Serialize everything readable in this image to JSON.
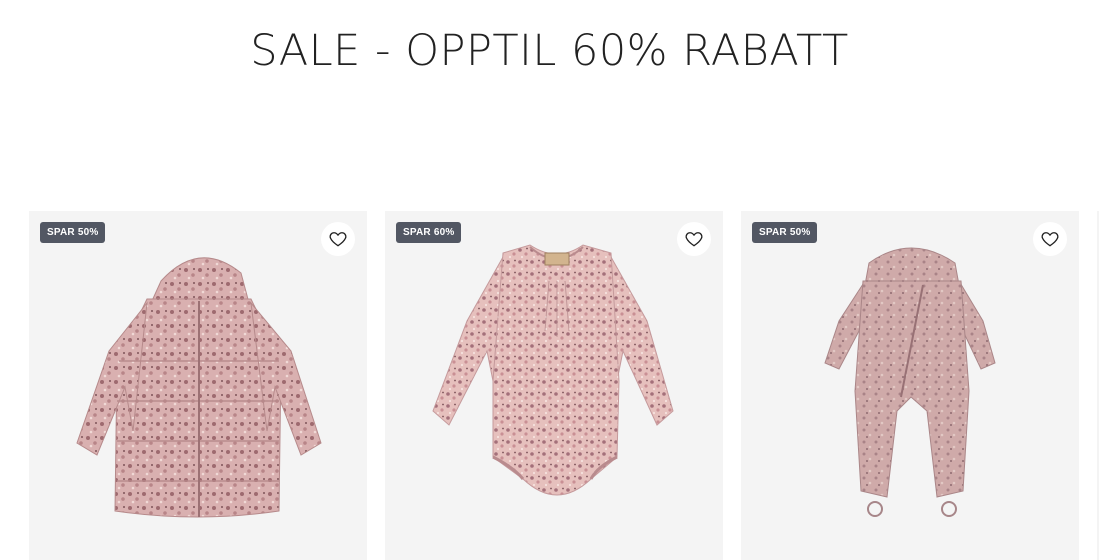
{
  "page": {
    "title": "SALE - OPPTIL 60% RABATT"
  },
  "products": [
    {
      "badge": "SPAR 50%",
      "image": "floral puffer jacket",
      "favorite_icon": "heart-icon"
    },
    {
      "badge": "SPAR 60%",
      "image": "floral long-sleeve bodysuit",
      "favorite_icon": "heart-icon"
    },
    {
      "badge": "SPAR 50%",
      "image": "floral snowsuit",
      "favorite_icon": "heart-icon"
    }
  ],
  "colors": {
    "badge_bg": "#525763",
    "card_bg": "#f4f4f4",
    "fabric": "#d8afb0"
  }
}
